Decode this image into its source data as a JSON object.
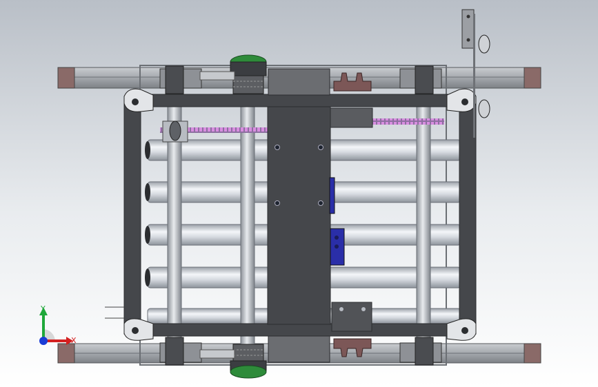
{
  "viewport": {
    "background_top": "#b9bfc7",
    "background_bottom": "#ffffff"
  },
  "model": {
    "colors": {
      "frame": "#45474b",
      "rail": "#b2b5b9",
      "roller": "#d9dde3",
      "chain": "#c47ac9",
      "sprocket_accent": "#2e8b3a",
      "bracket_blue": "#2a2ea8",
      "pad": "#8a6a68"
    }
  },
  "triad": {
    "x_label": "X",
    "y_label": "Y",
    "x_color": "#d42020",
    "y_color": "#1fa83a",
    "z_color": "#1a3cd6"
  }
}
